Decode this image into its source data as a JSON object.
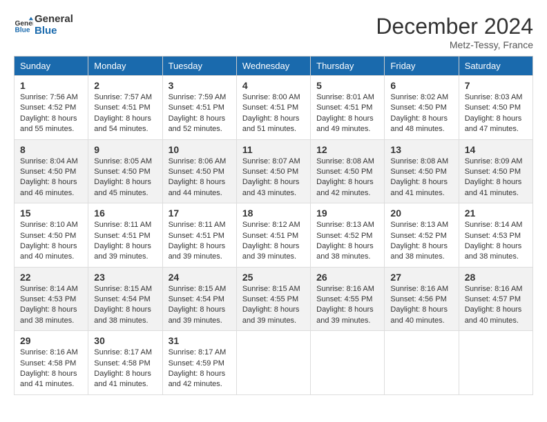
{
  "header": {
    "logo_line1": "General",
    "logo_line2": "Blue",
    "month_title": "December 2024",
    "subtitle": "Metz-Tessy, France"
  },
  "weekdays": [
    "Sunday",
    "Monday",
    "Tuesday",
    "Wednesday",
    "Thursday",
    "Friday",
    "Saturday"
  ],
  "weeks": [
    [
      {
        "day": "1",
        "sunrise": "7:56 AM",
        "sunset": "4:52 PM",
        "daylight": "8 hours and 55 minutes."
      },
      {
        "day": "2",
        "sunrise": "7:57 AM",
        "sunset": "4:51 PM",
        "daylight": "8 hours and 54 minutes."
      },
      {
        "day": "3",
        "sunrise": "7:59 AM",
        "sunset": "4:51 PM",
        "daylight": "8 hours and 52 minutes."
      },
      {
        "day": "4",
        "sunrise": "8:00 AM",
        "sunset": "4:51 PM",
        "daylight": "8 hours and 51 minutes."
      },
      {
        "day": "5",
        "sunrise": "8:01 AM",
        "sunset": "4:51 PM",
        "daylight": "8 hours and 49 minutes."
      },
      {
        "day": "6",
        "sunrise": "8:02 AM",
        "sunset": "4:50 PM",
        "daylight": "8 hours and 48 minutes."
      },
      {
        "day": "7",
        "sunrise": "8:03 AM",
        "sunset": "4:50 PM",
        "daylight": "8 hours and 47 minutes."
      }
    ],
    [
      {
        "day": "8",
        "sunrise": "8:04 AM",
        "sunset": "4:50 PM",
        "daylight": "8 hours and 46 minutes."
      },
      {
        "day": "9",
        "sunrise": "8:05 AM",
        "sunset": "4:50 PM",
        "daylight": "8 hours and 45 minutes."
      },
      {
        "day": "10",
        "sunrise": "8:06 AM",
        "sunset": "4:50 PM",
        "daylight": "8 hours and 44 minutes."
      },
      {
        "day": "11",
        "sunrise": "8:07 AM",
        "sunset": "4:50 PM",
        "daylight": "8 hours and 43 minutes."
      },
      {
        "day": "12",
        "sunrise": "8:08 AM",
        "sunset": "4:50 PM",
        "daylight": "8 hours and 42 minutes."
      },
      {
        "day": "13",
        "sunrise": "8:08 AM",
        "sunset": "4:50 PM",
        "daylight": "8 hours and 41 minutes."
      },
      {
        "day": "14",
        "sunrise": "8:09 AM",
        "sunset": "4:50 PM",
        "daylight": "8 hours and 41 minutes."
      }
    ],
    [
      {
        "day": "15",
        "sunrise": "8:10 AM",
        "sunset": "4:50 PM",
        "daylight": "8 hours and 40 minutes."
      },
      {
        "day": "16",
        "sunrise": "8:11 AM",
        "sunset": "4:51 PM",
        "daylight": "8 hours and 39 minutes."
      },
      {
        "day": "17",
        "sunrise": "8:11 AM",
        "sunset": "4:51 PM",
        "daylight": "8 hours and 39 minutes."
      },
      {
        "day": "18",
        "sunrise": "8:12 AM",
        "sunset": "4:51 PM",
        "daylight": "8 hours and 39 minutes."
      },
      {
        "day": "19",
        "sunrise": "8:13 AM",
        "sunset": "4:52 PM",
        "daylight": "8 hours and 38 minutes."
      },
      {
        "day": "20",
        "sunrise": "8:13 AM",
        "sunset": "4:52 PM",
        "daylight": "8 hours and 38 minutes."
      },
      {
        "day": "21",
        "sunrise": "8:14 AM",
        "sunset": "4:53 PM",
        "daylight": "8 hours and 38 minutes."
      }
    ],
    [
      {
        "day": "22",
        "sunrise": "8:14 AM",
        "sunset": "4:53 PM",
        "daylight": "8 hours and 38 minutes."
      },
      {
        "day": "23",
        "sunrise": "8:15 AM",
        "sunset": "4:54 PM",
        "daylight": "8 hours and 38 minutes."
      },
      {
        "day": "24",
        "sunrise": "8:15 AM",
        "sunset": "4:54 PM",
        "daylight": "8 hours and 39 minutes."
      },
      {
        "day": "25",
        "sunrise": "8:15 AM",
        "sunset": "4:55 PM",
        "daylight": "8 hours and 39 minutes."
      },
      {
        "day": "26",
        "sunrise": "8:16 AM",
        "sunset": "4:55 PM",
        "daylight": "8 hours and 39 minutes."
      },
      {
        "day": "27",
        "sunrise": "8:16 AM",
        "sunset": "4:56 PM",
        "daylight": "8 hours and 40 minutes."
      },
      {
        "day": "28",
        "sunrise": "8:16 AM",
        "sunset": "4:57 PM",
        "daylight": "8 hours and 40 minutes."
      }
    ],
    [
      {
        "day": "29",
        "sunrise": "8:16 AM",
        "sunset": "4:58 PM",
        "daylight": "8 hours and 41 minutes."
      },
      {
        "day": "30",
        "sunrise": "8:17 AM",
        "sunset": "4:58 PM",
        "daylight": "8 hours and 41 minutes."
      },
      {
        "day": "31",
        "sunrise": "8:17 AM",
        "sunset": "4:59 PM",
        "daylight": "8 hours and 42 minutes."
      },
      null,
      null,
      null,
      null
    ]
  ],
  "labels": {
    "sunrise": "Sunrise:",
    "sunset": "Sunset:",
    "daylight": "Daylight:"
  }
}
